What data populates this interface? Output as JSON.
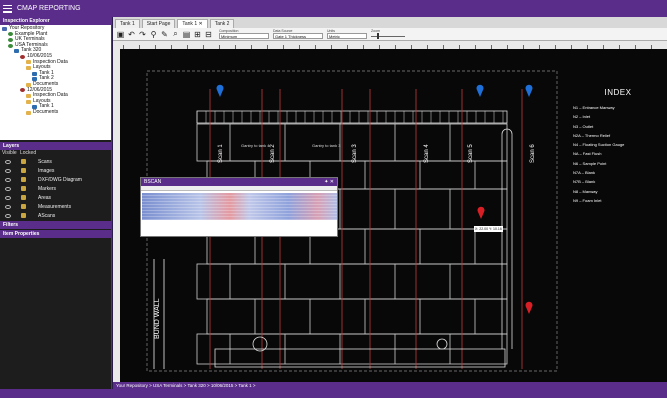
{
  "app": {
    "title": "CMAP REPORTING"
  },
  "explorer": {
    "title": "Inspection Explorer",
    "nodes": [
      {
        "label": "Your Repository",
        "icon": "repo-icon",
        "depth": 0
      },
      {
        "label": "Example Plant",
        "icon": "globe-icon",
        "depth": 1
      },
      {
        "label": "UK Terminals",
        "icon": "globe-icon",
        "depth": 1
      },
      {
        "label": "USA Terminals",
        "icon": "globe-icon",
        "depth": 1
      },
      {
        "label": "Tank 320",
        "icon": "tank-icon",
        "depth": 2
      },
      {
        "label": "10/06/2015",
        "icon": "date-icon",
        "depth": 3
      },
      {
        "label": "Inspection Data",
        "icon": "folder-icon",
        "depth": 4
      },
      {
        "label": "Layouts",
        "icon": "folder-icon",
        "depth": 4
      },
      {
        "label": "Tank 1",
        "icon": "tank-icon",
        "depth": 5
      },
      {
        "label": "Tank 2",
        "icon": "tank-icon",
        "depth": 5
      },
      {
        "label": "Documents",
        "icon": "folder-icon",
        "depth": 4
      },
      {
        "label": "12/06/2015",
        "icon": "date-icon",
        "depth": 3
      },
      {
        "label": "Inspection Data",
        "icon": "folder-icon",
        "depth": 4
      },
      {
        "label": "Layouts",
        "icon": "folder-icon",
        "depth": 4
      },
      {
        "label": "Tank 1",
        "icon": "tank-icon",
        "depth": 5
      },
      {
        "label": "Documents",
        "icon": "folder-icon",
        "depth": 4
      }
    ]
  },
  "layers": {
    "title": "Layers",
    "col_visible": "Visible",
    "col_locked": "Locked",
    "items": [
      "Scans",
      "Images",
      "DXF/DWG Diagram",
      "Markers",
      "Areas",
      "Measurements",
      "AScans"
    ]
  },
  "filters": {
    "title": "Filters"
  },
  "itemprops": {
    "title": "Item Properties"
  },
  "tabs": [
    {
      "label": "Tank 1",
      "active": false,
      "closable": false
    },
    {
      "label": "Start Page",
      "active": false,
      "closable": false
    },
    {
      "label": "Tank 1",
      "active": true,
      "closable": true
    },
    {
      "label": "Tank 2",
      "active": false,
      "closable": false
    }
  ],
  "toolbar": {
    "composition_label": "Composition",
    "composition_value": "Minimum",
    "datasource_label": "Data Source",
    "datasource_value": "Gate 1 Thickness",
    "units_label": "Units",
    "units_value": "Metric",
    "zoom_label": "Zoom"
  },
  "bscan": {
    "title": "BSCAN"
  },
  "index": {
    "title": "INDEX",
    "items": [
      "N1 – Entrance Manway",
      "N2 – Inlet",
      "N3 – Outlet",
      "N2A – Thermo Relief",
      "N4 – Floating Suction Gauge",
      "NA – Fast Flush",
      "N6 – Sample Point",
      "N7A – Blank",
      "N7B – Blank",
      "N8 – Manway",
      "N9 – Foam Inlet"
    ]
  },
  "drawing": {
    "gantry1": "Gantry to tank 4",
    "gantry2": "Gantry to tank 3",
    "bund_wall": "BUND WALL",
    "scans": [
      "Scan 1",
      "Scan 2",
      "Scan 3",
      "Scan 4",
      "Scan 5",
      "Scan 6"
    ],
    "marker_note": "X: 22.00 Y: 10.16"
  },
  "breadcrumb": "Your Repository > USA Terminals > Tank 320 > 10/06/2015 > Tank 1 >",
  "colors": {
    "accent": "#5a2d8a",
    "marker": "#d81f26",
    "pin": "#1e6fd8"
  }
}
